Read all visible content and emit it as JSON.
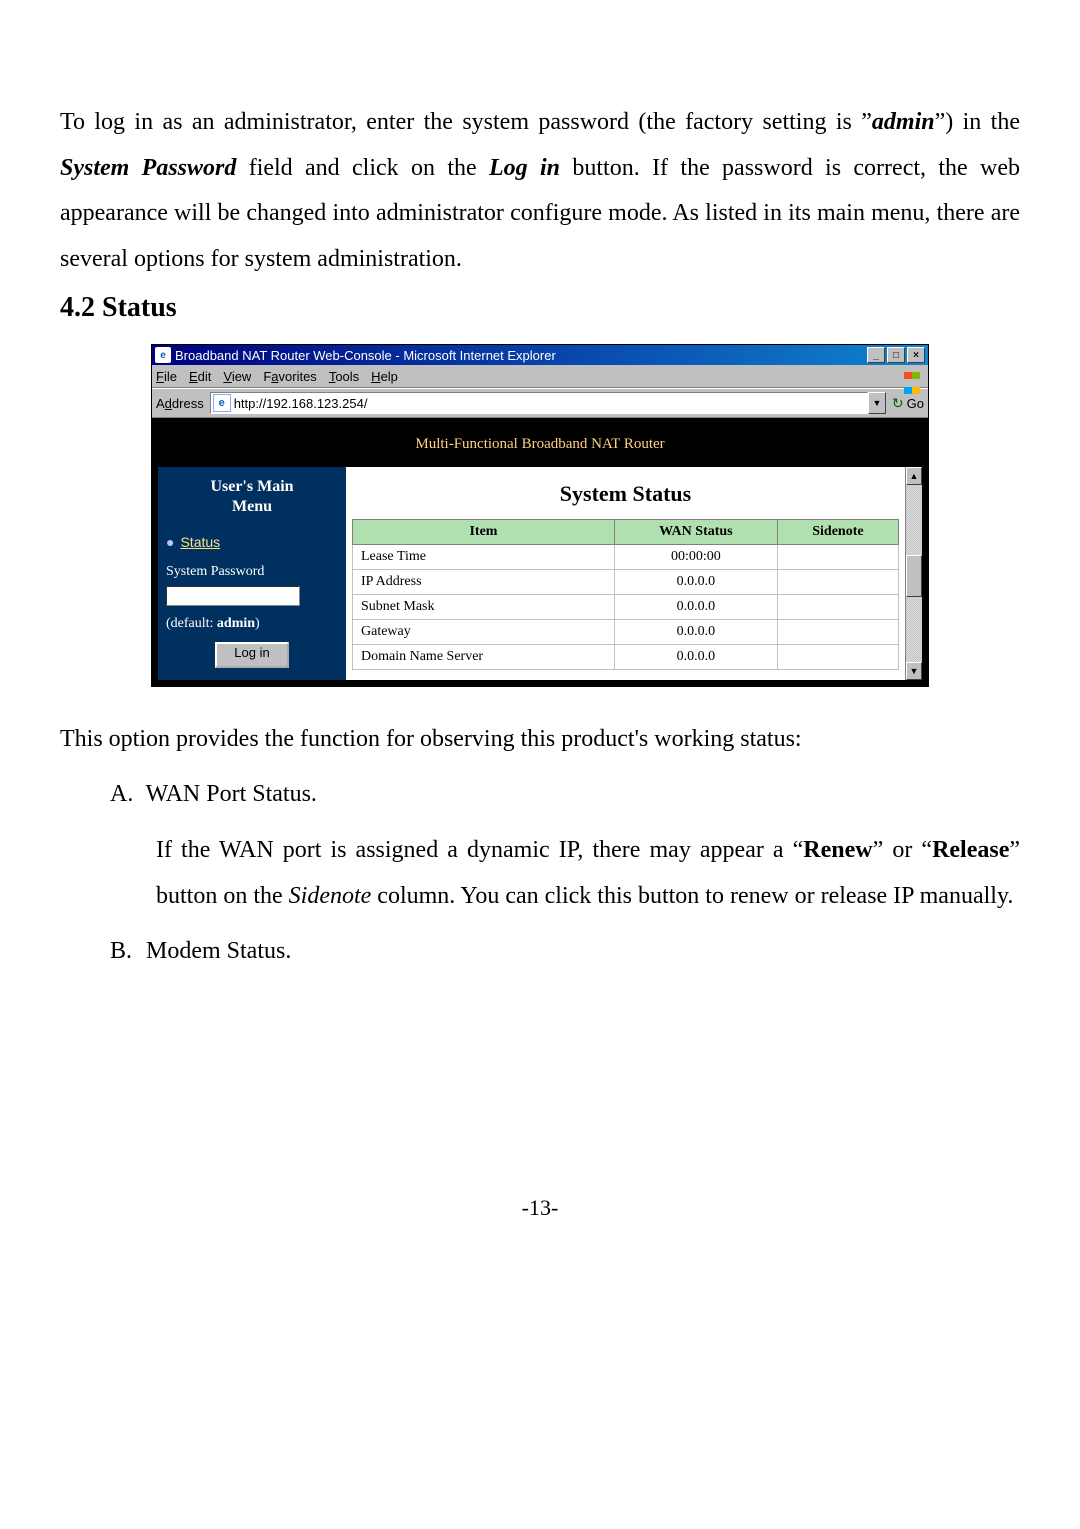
{
  "doc": {
    "intro": "To log in as an administrator, enter the system password (the factory setting is \"admin\") in the System Password field and click on the Log in button. If the password is correct, the web appearance will be changed into administrator configure mode. As listed in its main menu, there are several options for system administration.",
    "section_number": "4.2",
    "section_title": "Status",
    "after_fig": "This option provides the function for observing this product's working status:",
    "list": {
      "a_letter": "A.",
      "a_title": "WAN Port Status.",
      "a_body": "If the WAN port is assigned a dynamic IP, there may appear a \"Renew\" or \"Release\" button on the Sidenote column. You can click this button to renew or release IP manually.",
      "b_letter": "B.",
      "b_title": "Modem Status."
    },
    "page_number": "-13-"
  },
  "ie": {
    "title": "Broadband NAT Router Web-Console - Microsoft Internet Explorer",
    "menu": {
      "file": "File",
      "edit": "Edit",
      "view": "View",
      "fav": "Favorites",
      "tools": "Tools",
      "help": "Help"
    },
    "address_label": "Address",
    "url": "http://192.168.123.254/",
    "go": "Go"
  },
  "router": {
    "banner": "Multi-Functional Broadband NAT Router",
    "menu_title_1": "User's Main",
    "menu_title_2": "Menu",
    "status_link": "Status",
    "syspass_label": "System Password",
    "default_label": "(default: admin)",
    "login_label": "Log in",
    "content_title": "System Status",
    "table": {
      "h_item": "Item",
      "h_wan": "WAN Status",
      "h_side": "Sidenote",
      "rows": [
        {
          "item": "Lease Time",
          "wan": "00:00:00",
          "side": ""
        },
        {
          "item": "IP Address",
          "wan": "0.0.0.0",
          "side": ""
        },
        {
          "item": "Subnet Mask",
          "wan": "0.0.0.0",
          "side": ""
        },
        {
          "item": "Gateway",
          "wan": "0.0.0.0",
          "side": ""
        },
        {
          "item": "Domain Name Server",
          "wan": "0.0.0.0",
          "side": ""
        }
      ]
    }
  }
}
